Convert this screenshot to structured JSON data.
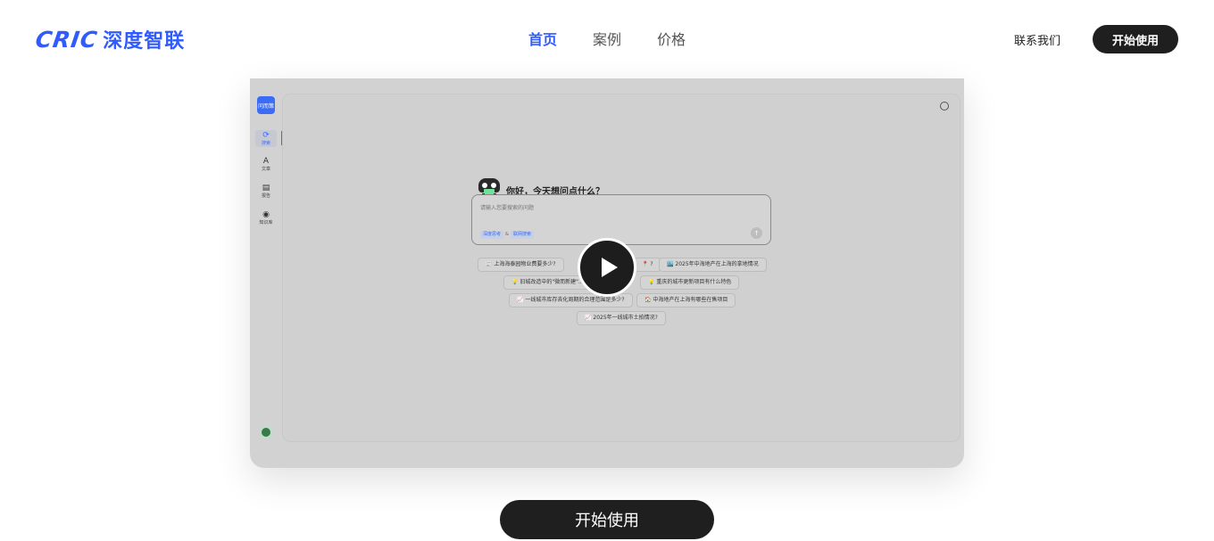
{
  "header": {
    "logo_en": "CRIC",
    "logo_cn": "深度智联",
    "nav": [
      {
        "label": "首页",
        "active": true
      },
      {
        "label": "案例",
        "active": false
      },
      {
        "label": "价格",
        "active": false
      }
    ],
    "contact_label": "联系我们",
    "start_label": "开始使用"
  },
  "video": {
    "app": {
      "logo_text": "问而策",
      "sidebar": [
        {
          "icon": "search-icon",
          "label": "搜索"
        },
        {
          "icon": "article-icon",
          "label": "文章"
        },
        {
          "icon": "report-icon",
          "label": "报告"
        },
        {
          "icon": "knowledge-icon",
          "label": "知识库"
        }
      ],
      "greeting": "你好，今天想问点什么？",
      "query_placeholder": "请输入您要搜索的问题",
      "tags": [
        "深度思考",
        "&",
        "联网搜索"
      ],
      "chips": [
        "📰 上海海泰园物业费要多少?",
        "📍 ?",
        "🏙️ 2025年中海地产在上海的拿地情况",
        "💡 旧城改造中的\"微而新建\"...",
        "💡 重庆的城市更新项目有什么特色",
        "📈 一线城市库存去化周期的合理范围是多少?",
        "🏠 中海地产在上海有哪些在售项目",
        "📈 2025年一线城市土拍情况?"
      ]
    },
    "play_label": "play"
  },
  "cta_label": "开始使用",
  "colors": {
    "brand": "#2f5bff",
    "dark_button": "#1f1f1f"
  }
}
